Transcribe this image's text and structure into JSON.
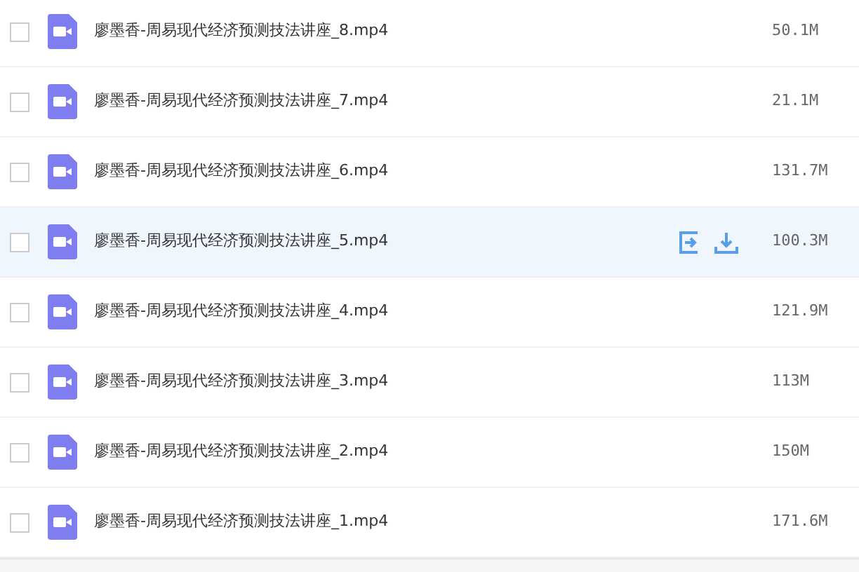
{
  "files": [
    {
      "name": "廖墨香-周易现代经济预测技法讲座_8.mp4",
      "size": "50.1M",
      "checked": false,
      "hovered": false
    },
    {
      "name": "廖墨香-周易现代经济预测技法讲座_7.mp4",
      "size": "21.1M",
      "checked": false,
      "hovered": false
    },
    {
      "name": "廖墨香-周易现代经济预测技法讲座_6.mp4",
      "size": "131.7M",
      "checked": false,
      "hovered": false
    },
    {
      "name": "廖墨香-周易现代经济预测技法讲座_5.mp4",
      "size": "100.3M",
      "checked": false,
      "hovered": true
    },
    {
      "name": "廖墨香-周易现代经济预测技法讲座_4.mp4",
      "size": "121.9M",
      "checked": false,
      "hovered": false
    },
    {
      "name": "廖墨香-周易现代经济预测技法讲座_3.mp4",
      "size": "113M",
      "checked": false,
      "hovered": false
    },
    {
      "name": "廖墨香-周易现代经济预测技法讲座_2.mp4",
      "size": "150M",
      "checked": false,
      "hovered": false
    },
    {
      "name": "廖墨香-周易现代经济预测技法讲座_1.mp4",
      "size": "171.6M",
      "checked": false,
      "hovered": false
    }
  ]
}
